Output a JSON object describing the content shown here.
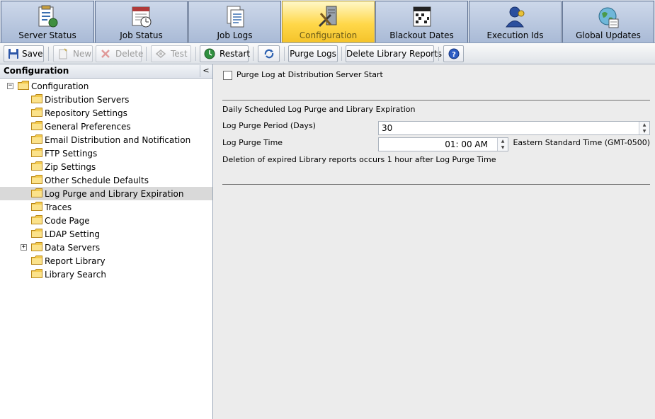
{
  "tabs": [
    {
      "label": "Server Status",
      "icon": "server-status-icon",
      "active": false
    },
    {
      "label": "Job Status",
      "icon": "job-status-icon",
      "active": false
    },
    {
      "label": "Job Logs",
      "icon": "job-logs-icon",
      "active": false
    },
    {
      "label": "Configuration",
      "icon": "configuration-icon",
      "active": true
    },
    {
      "label": "Blackout Dates",
      "icon": "calendar-icon",
      "active": false
    },
    {
      "label": "Execution Ids",
      "icon": "user-icon",
      "active": false
    },
    {
      "label": "Global Updates",
      "icon": "globe-icon",
      "active": false
    }
  ],
  "toolbar": {
    "save": "Save",
    "new": "New",
    "delete": "Delete",
    "test": "Test",
    "restart": "Restart",
    "purge_logs": "Purge Logs",
    "delete_library_reports": "Delete Library Reports",
    "help_glyph": "?"
  },
  "left_panel": {
    "title": "Configuration",
    "collapse_glyph": "<",
    "tree": [
      {
        "label": "Configuration",
        "expander": "−"
      },
      {
        "label": "Distribution Servers"
      },
      {
        "label": "Repository Settings"
      },
      {
        "label": "General Preferences"
      },
      {
        "label": "Email Distribution and Notification"
      },
      {
        "label": "FTP Settings"
      },
      {
        "label": "Zip Settings"
      },
      {
        "label": "Other Schedule Defaults"
      },
      {
        "label": "Log Purge and Library Expiration",
        "selected": true
      },
      {
        "label": "Traces"
      },
      {
        "label": "Code Page"
      },
      {
        "label": "LDAP Setting"
      },
      {
        "label": "Data Servers",
        "expander": "+"
      },
      {
        "label": "Report Library"
      },
      {
        "label": "Library Search"
      }
    ]
  },
  "form": {
    "purge_on_start_label": "Purge Log at Distribution Server Start",
    "purge_on_start_checked": false,
    "section_title": "Daily Scheduled Log Purge and Library Expiration",
    "purge_period_label": "Log Purge Period (Days)",
    "purge_period_value": "30",
    "purge_time_label": "Log Purge Time",
    "purge_time_value": "01: 00 AM",
    "timezone": "Eastern Standard Time (GMT-0500)",
    "note": "Deletion of expired Library reports occurs 1 hour after Log Purge Time"
  },
  "colors": {
    "active_tab": "#ffd84a",
    "tab": "#b4c3dc",
    "selected_row": "#d9d9d9",
    "folder": "#f2c94c"
  }
}
